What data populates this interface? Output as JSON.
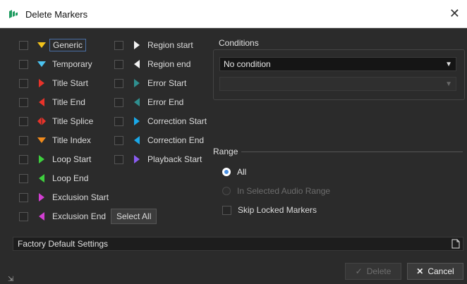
{
  "window": {
    "title": "Delete Markers",
    "close_symbol": "✕"
  },
  "markers_left": [
    {
      "label": "Generic",
      "icon": "generic-marker-icon",
      "color": "#f2c21b",
      "shape": "down",
      "focused": true
    },
    {
      "label": "Temporary",
      "icon": "temporary-marker-icon",
      "color": "#4cc3f0",
      "shape": "down"
    },
    {
      "label": "Title Start",
      "icon": "title-start-icon",
      "color": "#e8332a",
      "shape": "right"
    },
    {
      "label": "Title End",
      "icon": "title-end-icon",
      "color": "#e8332a",
      "shape": "left"
    },
    {
      "label": "Title Splice",
      "icon": "title-splice-icon",
      "color": "#e8332a",
      "shape": "diamond"
    },
    {
      "label": "Title Index",
      "icon": "title-index-icon",
      "color": "#f08a1c",
      "shape": "down"
    },
    {
      "label": "Loop Start",
      "icon": "loop-start-icon",
      "color": "#3ecf3e",
      "shape": "right"
    },
    {
      "label": "Loop End",
      "icon": "loop-end-icon",
      "color": "#3ecf3e",
      "shape": "left"
    },
    {
      "label": "Exclusion Start",
      "icon": "exclusion-start-icon",
      "color": "#d23fd2",
      "shape": "right"
    },
    {
      "label": "Exclusion End",
      "icon": "exclusion-end-icon",
      "color": "#d23fd2",
      "shape": "left"
    }
  ],
  "markers_right": [
    {
      "label": "Region start",
      "icon": "region-start-icon",
      "color": "#f2f2f2",
      "shape": "right"
    },
    {
      "label": "Region end",
      "icon": "region-end-icon",
      "color": "#f2f2f2",
      "shape": "left"
    },
    {
      "label": "Error Start",
      "icon": "error-start-icon",
      "color": "#2f8f8f",
      "shape": "right"
    },
    {
      "label": "Error End",
      "icon": "error-end-icon",
      "color": "#2f8f8f",
      "shape": "left"
    },
    {
      "label": "Correction Start",
      "icon": "correction-start-icon",
      "color": "#1aa8e8",
      "shape": "right"
    },
    {
      "label": "Correction End",
      "icon": "correction-end-icon",
      "color": "#1aa8e8",
      "shape": "left"
    },
    {
      "label": "Playback Start",
      "icon": "playback-start-icon",
      "color": "#8a5cf0",
      "shape": "right"
    }
  ],
  "select_all_label": "Select All",
  "conditions": {
    "title": "Conditions",
    "selected": "No condition",
    "secondary_selected": ""
  },
  "range": {
    "title": "Range",
    "options": [
      {
        "label": "All",
        "selected": true,
        "enabled": true
      },
      {
        "label": "In Selected Audio Range",
        "selected": false,
        "enabled": false
      }
    ],
    "skip_locked_label": "Skip Locked Markers"
  },
  "factory_default": "Factory Default Settings",
  "buttons": {
    "delete_label": "Delete",
    "cancel_label": "Cancel"
  },
  "colors": {
    "accent": "#4a90e2",
    "background": "#2b2b2b"
  }
}
